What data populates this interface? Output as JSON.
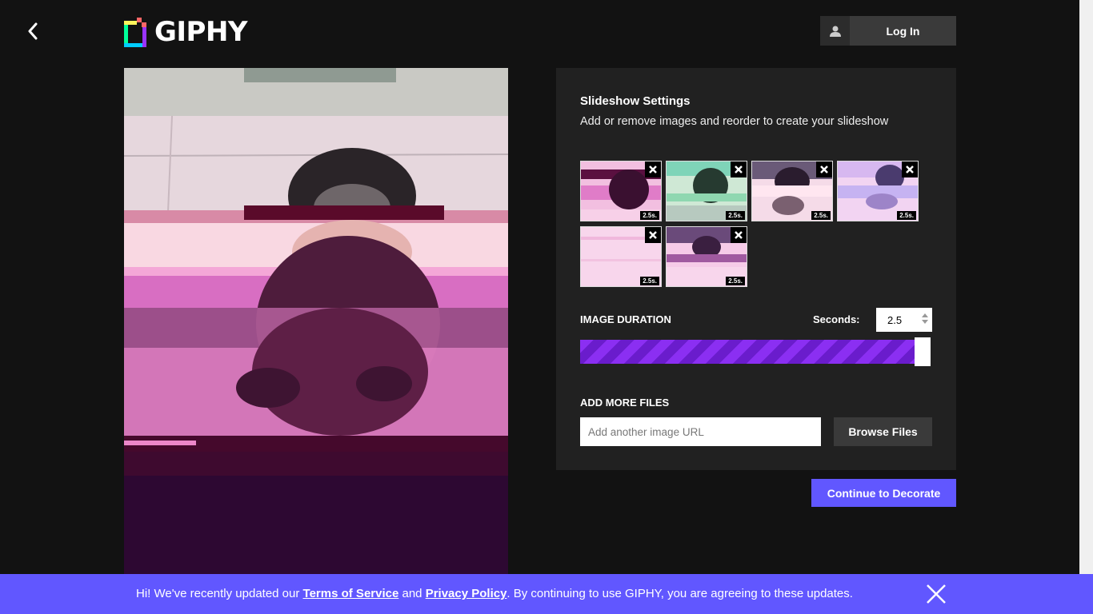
{
  "header": {
    "logo_text": "GIPHY",
    "login_label": "Log In"
  },
  "settings": {
    "title": "Slideshow Settings",
    "subtitle": "Add or remove images and reorder to create your slideshow",
    "thumbnails": [
      {
        "duration": "2.5s."
      },
      {
        "duration": "2.5s."
      },
      {
        "duration": "2.5s."
      },
      {
        "duration": "2.5s."
      },
      {
        "duration": "2.5s."
      },
      {
        "duration": "2.5s."
      }
    ],
    "image_duration_label": "IMAGE DURATION",
    "seconds_label": "Seconds:",
    "seconds_value": "2.5",
    "slider_fraction": 0.95,
    "add_more_label": "ADD MORE FILES",
    "url_placeholder": "Add another image URL",
    "browse_label": "Browse Files"
  },
  "continue_label": "Continue to Decorate",
  "banner": {
    "prefix": "Hi! We've recently updated our ",
    "terms": "Terms of Service",
    "and": " and ",
    "privacy": "Privacy Policy",
    "suffix": ". By continuing to use GIPHY, you are agreeing to these updates."
  },
  "colors": {
    "accent": "#6157ff",
    "slider": "#8b2ff2",
    "background": "#121212",
    "panel": "#212121"
  },
  "icons": [
    "back-arrow-icon",
    "giphy-logo-icon",
    "user-icon",
    "close-icon",
    "spinner-icon"
  ]
}
